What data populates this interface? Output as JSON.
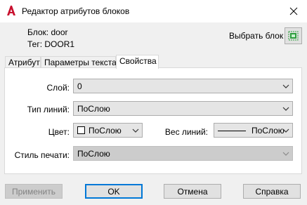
{
  "window": {
    "title": "Редактор атрибутов блоков"
  },
  "block_info": {
    "block_line": "Блок: door",
    "tag_line": "Тег: DOOR1"
  },
  "pick_block": {
    "label": "Выбрать блок"
  },
  "tabs": [
    {
      "label": "Атрибут",
      "active": false
    },
    {
      "label": "Параметры текста",
      "active": false
    },
    {
      "label": "Свойства",
      "active": true
    }
  ],
  "properties": {
    "layer_label": "Слой:",
    "layer_value": "0",
    "linetype_label": "Тип линий:",
    "linetype_value": "ПоСлою",
    "color_label": "Цвет:",
    "color_value": "ПоСлою",
    "lineweight_label": "Вес линий:",
    "lineweight_value": "ПоСлою",
    "plotstyle_label": "Стиль печати:",
    "plotstyle_value": "ПоСлою"
  },
  "buttons": {
    "apply": "Применить",
    "ok": "OK",
    "cancel": "Отмена",
    "help": "Справка"
  },
  "colors": {
    "app_icon": "#c8102e",
    "accent": "#0078d7",
    "pick_icon": "#2e9e3e"
  }
}
